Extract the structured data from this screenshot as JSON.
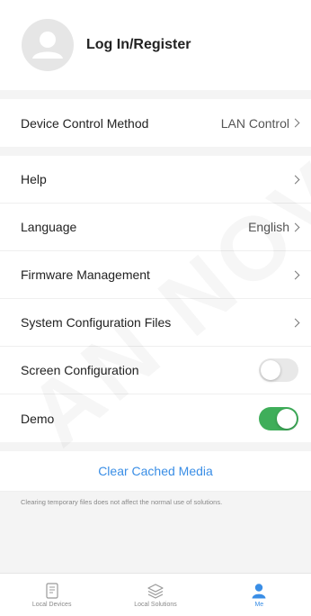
{
  "profile": {
    "name": "Log In/Register",
    "avatar_icon": "user-avatar-icon"
  },
  "settings": {
    "device_control": {
      "label": "Device Control Method",
      "value": "LAN Control"
    },
    "help": {
      "label": "Help"
    },
    "language": {
      "label": "Language",
      "value": "English"
    },
    "firmware": {
      "label": "Firmware Management"
    },
    "config_files": {
      "label": "System Configuration Files"
    },
    "screen_config": {
      "label": "Screen Configuration",
      "enabled": false
    },
    "demo": {
      "label": "Demo",
      "enabled": true
    }
  },
  "cache": {
    "clear_label": "Clear Cached Media",
    "note": "Clearing temporary files does not affect the normal use of solutions."
  },
  "tabs": [
    {
      "label": "Local Devices",
      "icon": "device-icon",
      "active": false
    },
    {
      "label": "Local Solutions",
      "icon": "layers-icon",
      "active": false
    },
    {
      "label": "Me",
      "icon": "person-icon",
      "active": true
    }
  ],
  "watermark": "AN NOVA",
  "colors": {
    "accent": "#3a8ee6",
    "toggle_on": "#3fae5a"
  }
}
